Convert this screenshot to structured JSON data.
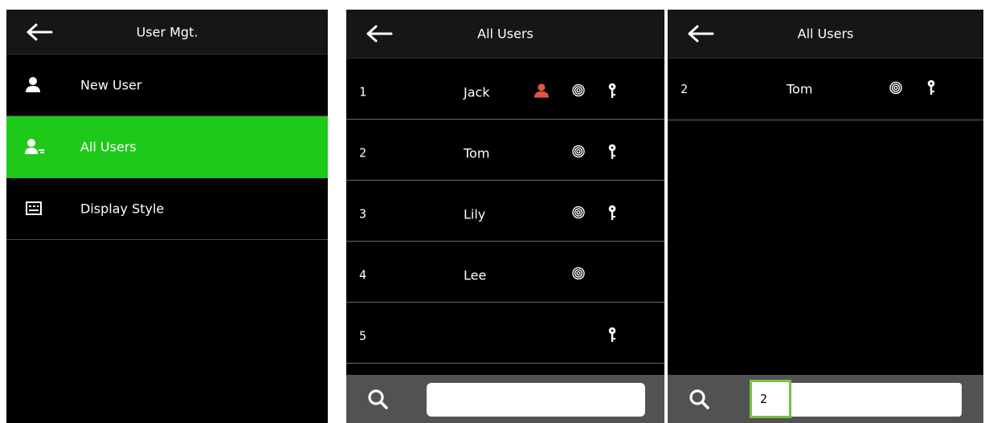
{
  "panel1": {
    "title": "User Mgt.",
    "items": [
      {
        "label": "New User",
        "icon": "user-icon"
      },
      {
        "label": "All Users",
        "icon": "user-list-icon",
        "active": true
      },
      {
        "label": "Display Style",
        "icon": "keyboard-icon"
      }
    ],
    "accent_color": "#1fc91a"
  },
  "panel2": {
    "title": "All Users",
    "rows": [
      {
        "id": "1",
        "name": "Jack",
        "face": true,
        "fingerprint": true,
        "password": true
      },
      {
        "id": "2",
        "name": "Tom",
        "face": false,
        "fingerprint": true,
        "password": true
      },
      {
        "id": "3",
        "name": "Lily",
        "face": false,
        "fingerprint": true,
        "password": true
      },
      {
        "id": "4",
        "name": "Lee",
        "face": false,
        "fingerprint": true,
        "password": false
      },
      {
        "id": "5",
        "name": "",
        "face": false,
        "fingerprint": false,
        "password": true
      }
    ],
    "search_value": ""
  },
  "panel3": {
    "title": "All Users",
    "rows": [
      {
        "id": "2",
        "name": "Tom",
        "face": false,
        "fingerprint": true,
        "password": true
      }
    ],
    "search_value": "2"
  }
}
